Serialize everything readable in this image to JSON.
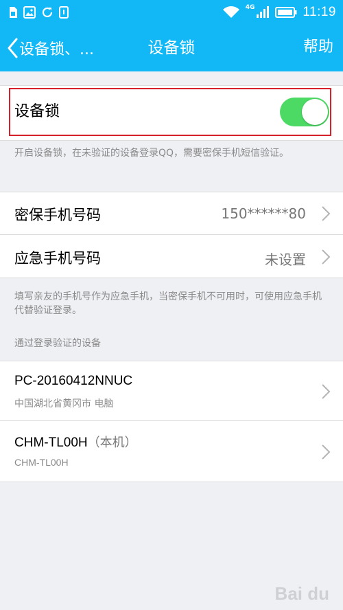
{
  "status_bar": {
    "time": "11:19",
    "network": "4G"
  },
  "nav": {
    "back_label": "设备锁、...",
    "title": "设备锁",
    "help_label": "帮助"
  },
  "device_lock": {
    "label": "设备锁",
    "enabled": true,
    "hint": "开启设备锁，在未验证的设备登录QQ，需要密保手机短信验证。"
  },
  "phones": {
    "security_phone": {
      "label": "密保手机号码",
      "value": "150******80"
    },
    "emergency_phone": {
      "label": "应急手机号码",
      "value": "未设置"
    },
    "hint": "填写亲友的手机号作为应急手机，当密保手机不可用时，可使用应急手机代替验证登录。"
  },
  "devices": {
    "section_title": "通过登录验证的设备",
    "items": [
      {
        "name": "PC-20160412NNUC",
        "tag": "",
        "subtitle": "中国湖北省黄冈市 电脑"
      },
      {
        "name": "CHM-TL00H",
        "tag": "（本机）",
        "subtitle": "CHM-TL00H"
      }
    ]
  },
  "colors": {
    "header_blue": "#12b7f5",
    "toggle_green": "#4cd964",
    "highlight_red": "#d6202a"
  }
}
